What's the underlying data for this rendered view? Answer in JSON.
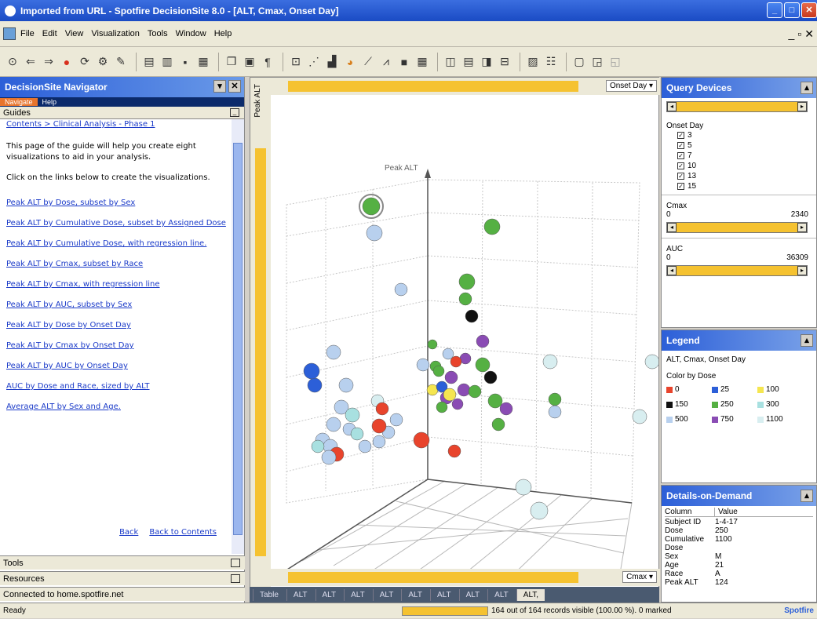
{
  "window": {
    "title": "Imported from URL - Spotfire DecisionSite 8.0 - [ALT, Cmax, Onset Day]"
  },
  "menu": {
    "items": [
      "File",
      "Edit",
      "View",
      "Visualization",
      "Tools",
      "Window",
      "Help"
    ]
  },
  "navigator": {
    "title": "DecisionSite Navigator",
    "tabs": [
      "Navigate",
      "Help"
    ],
    "guides_label": "Guides",
    "breadcrumb": "Contents > Clinical Analysis - Phase 1",
    "intro1": "This page of the guide will help you create eight visualizations to aid in your analysis.",
    "intro2": "Click on the links below to create the visualizations.",
    "links": [
      "Peak ALT by Dose, subset by Sex",
      "Peak ALT by Cumulative Dose, subset by Assigned Dose",
      "Peak ALT by Cumulative Dose, with regression line.",
      "Peak ALT by Cmax, subset by Race",
      "Peak ALT by Cmax, with regression line",
      "Peak ALT by AUC, subset by Sex",
      "Peak ALT by Dose by Onset Day",
      "Peak ALT by Cmax by Onset Day",
      "Peak ALT by AUC by Onset Day",
      "AUC by Dose and Race, sized by ALT",
      "Average ALT by Sex and Age."
    ],
    "back": "Back",
    "back_to_contents": "Back to Contents",
    "tools": "Tools",
    "resources": "Resources",
    "connected": "Connected to home.spotfire.net"
  },
  "plot": {
    "y_axis_selector": "Peak ALT",
    "top_selector": "Onset Day",
    "bottom_selector": "Cmax",
    "axis_title": "Peak ALT",
    "tabs": [
      "Table",
      "ALT",
      "ALT",
      "ALT",
      "ALT",
      "ALT",
      "ALT",
      "ALT",
      "ALT",
      "ALT,"
    ]
  },
  "query_devices": {
    "title": "Query Devices",
    "onset_label": "Onset Day",
    "onset_values": [
      "3",
      "5",
      "7",
      "10",
      "13",
      "15"
    ],
    "cmax_label": "Cmax",
    "cmax_min": "0",
    "cmax_max": "2340",
    "auc_label": "AUC",
    "auc_min": "0",
    "auc_max": "36309"
  },
  "legend": {
    "title": "Legend",
    "subtitle": "ALT, Cmax, Onset Day",
    "color_by": "Color by Dose",
    "items": [
      {
        "label": "0",
        "color": "#e8442c"
      },
      {
        "label": "25",
        "color": "#2c5fd8"
      },
      {
        "label": "100",
        "color": "#f5e650"
      },
      {
        "label": "150",
        "color": "#111111"
      },
      {
        "label": "250",
        "color": "#55b043"
      },
      {
        "label": "300",
        "color": "#a8e0e0"
      },
      {
        "label": "500",
        "color": "#b8d0ee"
      },
      {
        "label": "750",
        "color": "#8a4cb4"
      },
      {
        "label": "1100",
        "color": "#d8eef0"
      }
    ]
  },
  "details": {
    "title": "Details-on-Demand",
    "col_header": "Column",
    "val_header": "Value",
    "rows": [
      {
        "k": "Subject ID",
        "v": "1-4-17"
      },
      {
        "k": "Dose",
        "v": "250"
      },
      {
        "k": "Cumulative Dose",
        "v": "1100"
      },
      {
        "k": "Sex",
        "v": "M"
      },
      {
        "k": "Age",
        "v": "21"
      },
      {
        "k": "Race",
        "v": "A"
      },
      {
        "k": "Peak ALT",
        "v": "124"
      }
    ]
  },
  "status": {
    "left": "Ready",
    "records": "164 out of 164 records visible (100.00 %). 0 marked",
    "brand": "Spotfire"
  }
}
